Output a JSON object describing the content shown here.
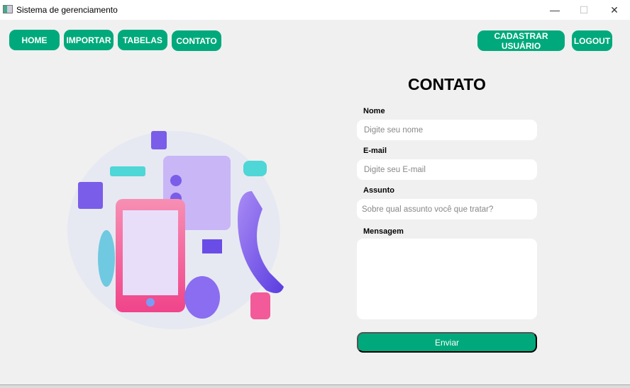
{
  "window": {
    "title": "Sistema de gerenciamento",
    "minimize": "—",
    "maximize": "☐",
    "close": "✕"
  },
  "nav": {
    "home": "HOME",
    "importar": "IMPORTAR",
    "tabelas": "TABELAS",
    "contato": "CONTATO",
    "cadastrar": "CADASTRAR USUÁRIO",
    "logout": "LOGOUT"
  },
  "form": {
    "title": "CONTATO",
    "nome_label": "Nome",
    "nome_placeholder": "Digite seu nome",
    "email_label": "E-mail",
    "email_placeholder": "Digite seu E-mail",
    "assunto_label": "Assunto",
    "assunto_placeholder": "Sobre qual assunto você que tratar?",
    "mensagem_label": "Mensagem",
    "submit": "Enviar"
  },
  "colors": {
    "accent": "#00a97b"
  }
}
